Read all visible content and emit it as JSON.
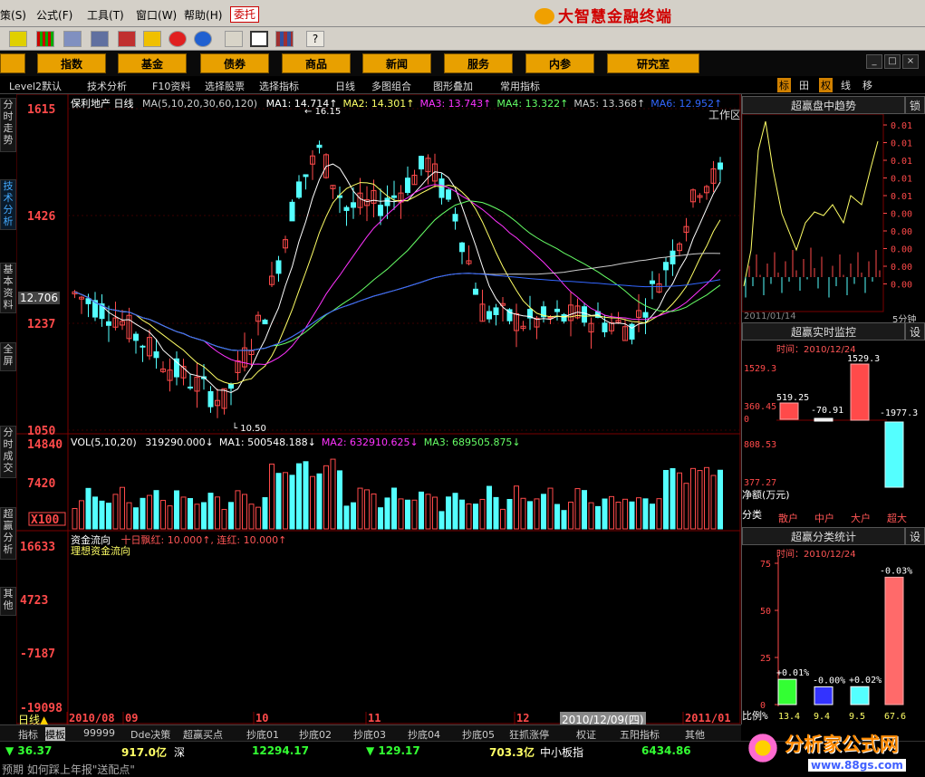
{
  "menu": [
    "策(",
    "公式(",
    "工具(",
    "窗口(",
    "帮助(",
    "委托"
  ],
  "menu_hotkeys": [
    "S)",
    "F)",
    "T)",
    "W)",
    "H)"
  ],
  "brand": "大智慧金融终端",
  "nav": [
    "指数",
    "基金",
    "债券",
    "商品",
    "新闻",
    "服务",
    "内参",
    "研究室"
  ],
  "workarea": "工作区",
  "workarea_toggle": "▼",
  "right_tabs": [
    "标",
    "田",
    "权",
    "线",
    "移"
  ],
  "subbar": [
    "Level2默认",
    "技术分析",
    "F10资料",
    "选择股票",
    "选择指标",
    "日线",
    "多图组合",
    "图形叠加",
    "常用指标"
  ],
  "side_tabs": [
    "分时走势",
    "技术分析",
    "基本资料",
    "全屏",
    "分时成交",
    "超赢分析",
    "其他"
  ],
  "chart_data": [
    {
      "type": "candlestick",
      "title": "保利地产 日线",
      "ma_header": "MA(5,10,20,30,60,120)",
      "ma_values": [
        {
          "name": "MA1:",
          "value": "14.714",
          "color": "#ffffff"
        },
        {
          "name": "MA2:",
          "value": "14.301",
          "color": "#ffff66"
        },
        {
          "name": "MA3:",
          "value": "13.743",
          "color": "#ff33ff"
        },
        {
          "name": "MA4:",
          "value": "13.322",
          "color": "#66ff66"
        },
        {
          "name": "MA5:",
          "value": "13.368",
          "color": "#cccccc"
        },
        {
          "name": "MA6:",
          "value": "12.952",
          "color": "#3366ff"
        }
      ],
      "y_ticks": [
        "1615",
        "1426",
        "1237",
        "1050"
      ],
      "ylim": [
        10.5,
        16.15
      ],
      "current_price": "12.706",
      "high_label": "16.15",
      "low_label": "10.50",
      "x_labels": [
        "2010/08",
        "09",
        "10",
        "11",
        "12",
        "2011/01"
      ],
      "cursor_date": "2010/12/09(四)",
      "period": "日线"
    },
    {
      "type": "bar",
      "title": "VOL(5,10,20)",
      "values_header": [
        {
          "name": "",
          "value": "319290.000↓",
          "color": "#ffffff"
        },
        {
          "name": "MA1:",
          "value": "500548.188↓",
          "color": "#ffffff"
        },
        {
          "name": "MA2:",
          "value": "632910.625↓",
          "color": "#ff33ff"
        },
        {
          "name": "MA3:",
          "value": "689505.875↓",
          "color": "#66ff66"
        }
      ],
      "y_ticks": [
        "14840",
        "7420",
        "X100"
      ]
    },
    {
      "type": "bar",
      "title": "资金流向",
      "subtitle": "十日飘红: 10.000↑, 连红: 10.000↑",
      "series_label": "理想资金流向",
      "y_ticks": [
        "16633",
        "4723",
        "-7187",
        "-19098"
      ]
    }
  ],
  "right_panels": {
    "trend_title": "超赢盘中趋势",
    "trend_lock": "锁",
    "trend_date": "2011/01/14",
    "trend_period": "5分钟",
    "trend_axis": [
      "0.01",
      "0.01",
      "0.01",
      "0.01",
      "0.01",
      "0.00",
      "0.00",
      "0.00",
      "0.00",
      "0.00"
    ],
    "monitor_title": "超赢实时监控",
    "monitor_btn": "设",
    "monitor_time": "时间：2010/12/24",
    "monitor_axis": [
      "1529.3",
      "360.45",
      "0",
      "808.53",
      "377.27"
    ],
    "monitor_values": [
      "519.25",
      "-70.91",
      "1529.3",
      "-1977.3"
    ],
    "net_label": "净额(万元)",
    "class_label": "分类",
    "classes": [
      "散户",
      "中户",
      "大户",
      "超大"
    ],
    "stat_title": "超赢分类统计",
    "stat_btn": "设",
    "stat_time": "时间：2010/12/24",
    "stat_axis": [
      "75",
      "50",
      "25",
      "0"
    ],
    "stat_top": "-0.03%",
    "stat_pcts": [
      "+0.01%",
      "-0.00%",
      "+0.02%"
    ],
    "ratio_label": "比例%",
    "ratios": [
      "13.4",
      "9.4",
      "9.5",
      "67.6"
    ]
  },
  "bottom_tabs": [
    "指标",
    "模板",
    "99999",
    "Dde决策",
    "超赢买点",
    "抄底01",
    "抄底02",
    "抄底03",
    "抄底04",
    "抄底05",
    "狂抓涨停",
    "权证",
    "五阳指标",
    "其他"
  ],
  "status": {
    "sh_change": "▼ 36.37",
    "sh_amount": "917.0亿",
    "sz_label": "深",
    "sz_index": "12294.17",
    "sz_change": "▼ 129.17",
    "sz_amount": "703.3亿",
    "sme_label": "中小板指",
    "sme_index": "6434.86",
    "ticker": "预期 如何踩上年报\"送配点\""
  },
  "watermark": {
    "name": "分析家公式网",
    "url": "www.88gs.com"
  },
  "colors": {
    "up": "#ff4a4a",
    "down": "#54ffff",
    "bg": "#000000",
    "nav": "#e8a000"
  }
}
